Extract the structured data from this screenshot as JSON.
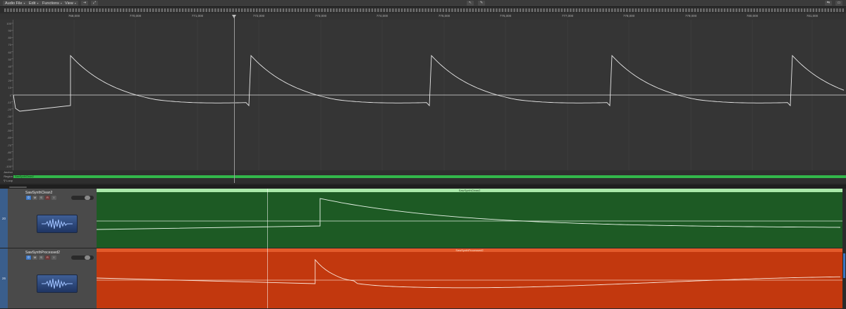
{
  "menubar": {
    "items": [
      {
        "label": "Audio File",
        "name": "menu-audio-file"
      },
      {
        "label": "Edit",
        "name": "menu-edit"
      },
      {
        "label": "Functions",
        "name": "menu-functions"
      },
      {
        "label": "View",
        "name": "menu-view"
      }
    ]
  },
  "ruler": {
    "labels": [
      "768,000",
      "770,000",
      "771,000",
      "772,000",
      "773,000",
      "774,000",
      "775,000",
      "776,000",
      "777,000",
      "778,000",
      "779,000",
      "780,000",
      "781,000"
    ]
  },
  "editor": {
    "y_labels": [
      "100",
      "90",
      "80",
      "70",
      "60",
      "50",
      "40",
      "30",
      "20",
      "10",
      "0",
      "-10",
      "-20",
      "-30",
      "-40",
      "-50",
      "-60",
      "-70",
      "-80",
      "-90",
      "-100"
    ],
    "rows": {
      "anchor_label": "Anchor",
      "region_label": "Region",
      "region_name": "SawSynthClean2",
      "loop_label": "⚲ Loop"
    }
  },
  "tracks": [
    {
      "number": "20",
      "name": "SawSynthClean2",
      "region_title": "SawSynthClean2",
      "lane_color": "#1d5a24",
      "title_color": "#a9e8a9",
      "buttons": [
        "⏻",
        "M",
        "S",
        "R",
        "I"
      ]
    },
    {
      "number": "26",
      "name": "SawSynthProcessed2",
      "region_title": "SawSynthProcessed2",
      "lane_color": "#c2380e",
      "title_color": "#e35a2a",
      "buttons": [
        "⏻",
        "M",
        "S",
        "R",
        "I"
      ]
    }
  ],
  "colors": {
    "waveform": "#e8e8e8",
    "region_green": "#32b64a",
    "accent_blue": "#3e79c8"
  }
}
